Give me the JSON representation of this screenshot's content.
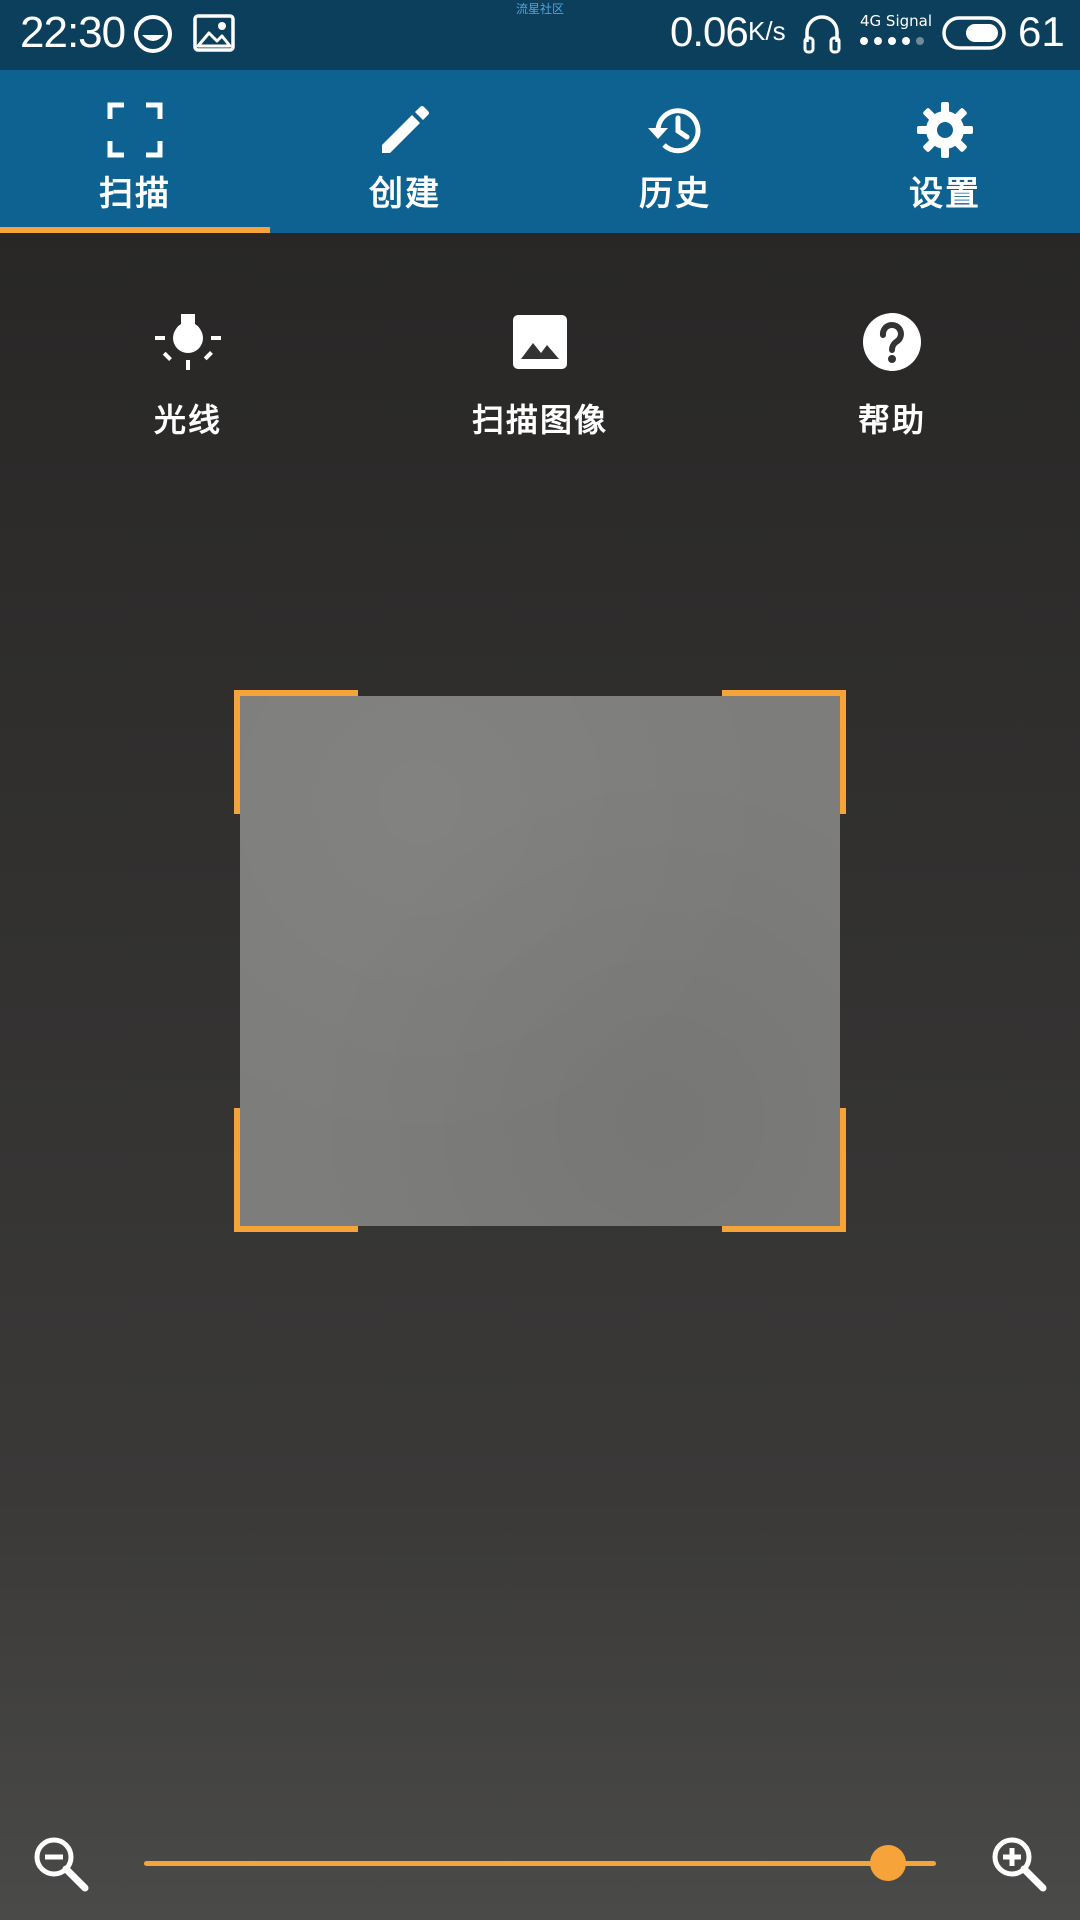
{
  "status_bar": {
    "time": "22:30",
    "carrier_text": "流星社区",
    "speed_value": "0.06",
    "speed_unit": "K/s",
    "signal_text": "4G Signal",
    "battery": "61"
  },
  "tabs": [
    {
      "label": "扫描",
      "icon": "scan-frame-icon",
      "selected": true
    },
    {
      "label": "创建",
      "icon": "pencil-icon",
      "selected": false
    },
    {
      "label": "历史",
      "icon": "history-icon",
      "selected": false
    },
    {
      "label": "设置",
      "icon": "gear-icon",
      "selected": false
    }
  ],
  "tools": [
    {
      "label": "光线",
      "icon": "flashlight-icon"
    },
    {
      "label": "扫描图像",
      "icon": "image-icon"
    },
    {
      "label": "帮助",
      "icon": "help-icon"
    }
  ],
  "zoom": {
    "level": 0.94
  },
  "colors": {
    "status_bar": "#0c3f5b",
    "tab_bar": "#0e6291",
    "accent": "#f6a43a",
    "frame_fill": "#7d7d7b"
  }
}
